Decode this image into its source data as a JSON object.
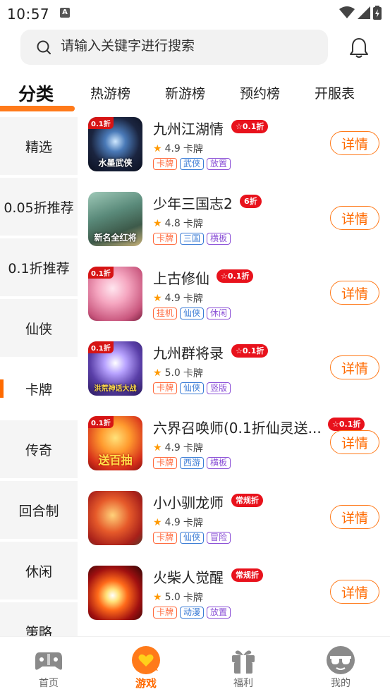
{
  "status_bar": {
    "time": "10:57",
    "a_icon": "A"
  },
  "search": {
    "placeholder": "请输入关键字进行搜索"
  },
  "tabs": [
    {
      "label": "分类",
      "active": true
    },
    {
      "label": "热游榜"
    },
    {
      "label": "新游榜"
    },
    {
      "label": "预约榜"
    },
    {
      "label": "开服表"
    }
  ],
  "sidebar": [
    {
      "label": "精选"
    },
    {
      "label": "0.05折推荐"
    },
    {
      "label": "0.1折推荐"
    },
    {
      "label": "仙侠"
    },
    {
      "label": "卡牌",
      "active": true
    },
    {
      "label": "传奇"
    },
    {
      "label": "回合制"
    },
    {
      "label": "休闲"
    },
    {
      "label": "策略"
    }
  ],
  "detail_label": "详情",
  "games": [
    {
      "name": "九州江湖情",
      "discount": "☆0.1折",
      "rating": "4.9",
      "genre": "卡牌",
      "cover_badge": "0.1折",
      "cover_text": "水墨武侠",
      "tags": [
        {
          "text": "卡牌",
          "color": "#ff6a3d"
        },
        {
          "text": "武侠",
          "color": "#3a7bd5"
        },
        {
          "text": "放置",
          "color": "#8a4fd6"
        }
      ]
    },
    {
      "name": "少年三国志2",
      "discount": "6折",
      "rating": "4.8",
      "genre": "卡牌",
      "cover_badge": "",
      "cover_text": "新名全红将",
      "tags": [
        {
          "text": "卡牌",
          "color": "#ff6a3d"
        },
        {
          "text": "三国",
          "color": "#3a7bd5"
        },
        {
          "text": "横板",
          "color": "#8a4fd6"
        }
      ]
    },
    {
      "name": "上古修仙",
      "discount": "☆0.1折",
      "rating": "4.9",
      "genre": "卡牌",
      "cover_badge": "0.1折",
      "cover_text": "",
      "tags": [
        {
          "text": "挂机",
          "color": "#ff6a3d"
        },
        {
          "text": "仙侠",
          "color": "#3a7bd5"
        },
        {
          "text": "休闲",
          "color": "#8a4fd6"
        }
      ]
    },
    {
      "name": "九州群将录",
      "discount": "☆0.1折",
      "rating": "5.0",
      "genre": "卡牌",
      "cover_badge": "0.1折",
      "cover_text": "洪荒神话大战",
      "tags": [
        {
          "text": "卡牌",
          "color": "#ff6a3d"
        },
        {
          "text": "仙侠",
          "color": "#3a7bd5"
        },
        {
          "text": "竖版",
          "color": "#8a4fd6"
        }
      ]
    },
    {
      "name": "六界召唤师(0.1折仙灵送...",
      "discount": "☆0.1折",
      "rating": "4.9",
      "genre": "卡牌",
      "cover_badge": "0.1折",
      "cover_text": "送百抽",
      "tags": [
        {
          "text": "卡牌",
          "color": "#ff6a3d"
        },
        {
          "text": "西游",
          "color": "#3a7bd5"
        },
        {
          "text": "横板",
          "color": "#8a4fd6"
        }
      ]
    },
    {
      "name": "小小驯龙师",
      "discount": "常规折",
      "rating": "4.9",
      "genre": "卡牌",
      "cover_badge": "",
      "cover_text": "",
      "tags": [
        {
          "text": "卡牌",
          "color": "#ff6a3d"
        },
        {
          "text": "仙侠",
          "color": "#3a7bd5"
        },
        {
          "text": "冒险",
          "color": "#8a4fd6"
        }
      ]
    },
    {
      "name": "火柴人觉醒",
      "discount": "常规折",
      "rating": "5.0",
      "genre": "卡牌",
      "cover_badge": "",
      "cover_text": "",
      "tags": [
        {
          "text": "卡牌",
          "color": "#ff6a3d"
        },
        {
          "text": "动漫",
          "color": "#3a7bd5"
        },
        {
          "text": "放置",
          "color": "#8a4fd6"
        }
      ]
    }
  ],
  "bottom_nav": [
    {
      "label": "首页",
      "icon": "gamepad-icon"
    },
    {
      "label": "游戏",
      "icon": "heart-chat-icon",
      "active": true
    },
    {
      "label": "福利",
      "icon": "gift-icon"
    },
    {
      "label": "我的",
      "icon": "sunglasses-face-icon"
    }
  ],
  "colors": {
    "accent": "#ff6a00",
    "discount_red": "#e8121c"
  }
}
